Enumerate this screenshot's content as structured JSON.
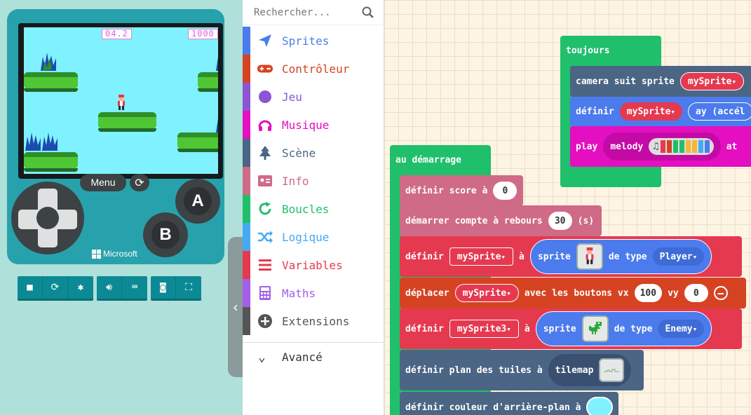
{
  "simulator": {
    "score_left": "04.2",
    "score_right": "1000",
    "menu_label": "Menu",
    "button_a": "A",
    "button_b": "B",
    "brand": "Microsoft",
    "collapse_glyph": "‹"
  },
  "toolbox": {
    "search_placeholder": "Rechercher...",
    "categories": [
      {
        "label": "Sprites",
        "color": "#4b7bec",
        "icon": "paper-plane-icon"
      },
      {
        "label": "Contrôleur",
        "color": "#d54322",
        "icon": "gamepad-icon"
      },
      {
        "label": "Jeu",
        "color": "#8b55d6",
        "icon": "circle-icon"
      },
      {
        "label": "Musique",
        "color": "#e30fc0",
        "icon": "headphones-icon"
      },
      {
        "label": "Scène",
        "color": "#4b6584",
        "icon": "tree-icon"
      },
      {
        "label": "Info",
        "color": "#cf6a87",
        "icon": "id-card-icon"
      },
      {
        "label": "Boucles",
        "color": "#20bf6b",
        "icon": "loop-icon"
      },
      {
        "label": "Logique",
        "color": "#45aaf2",
        "icon": "shuffle-icon"
      },
      {
        "label": "Variables",
        "color": "#e53950",
        "icon": "list-icon"
      },
      {
        "label": "Maths",
        "color": "#a55eea",
        "icon": "calculator-icon"
      },
      {
        "label": "Extensions",
        "color": "#555555",
        "icon": "plus-circle-icon"
      }
    ],
    "advanced_label": "Avancé"
  },
  "workspace": {
    "forever": {
      "hat": "toujours",
      "b1": {
        "text": "camera suit sprite",
        "var": "mySprite"
      },
      "b2": {
        "text": "définir",
        "var": "mySprite",
        "field": "ay (accél"
      },
      "b3": {
        "text": "play",
        "field": "melody",
        "tail": "at"
      }
    },
    "on_start": {
      "hat": "au démarrage",
      "score": {
        "text": "définir score à",
        "value": "0"
      },
      "countdown": {
        "text": "démarrer compte à rebours",
        "value": "30",
        "unit": "(s)"
      },
      "set_sprite": {
        "text": "définir",
        "var": "mySprite",
        "a": "à",
        "sprite": "sprite",
        "type_text": "de type",
        "kind": "Player"
      },
      "move": {
        "text": "déplacer",
        "var": "mySprite",
        "with": "avec les boutons vx",
        "vx": "100",
        "vy_label": "vy",
        "vy": "0"
      },
      "set_sprite3": {
        "text": "définir",
        "var": "mySprite3",
        "a": "à",
        "sprite": "sprite",
        "type_text": "de type",
        "kind": "Enemy"
      },
      "tilemap": {
        "text": "définir plan des tuiles à",
        "field": "tilemap"
      },
      "bg": {
        "text": "définir couleur d'arrière-plan à"
      }
    },
    "colors": {
      "sprites": "#4b7bec",
      "controller": "#d54322",
      "info": "#cf6a87",
      "variables": "#e53950",
      "loops": "#20bf6b",
      "music": "#e30fc0",
      "scene": "#4b6584"
    }
  }
}
